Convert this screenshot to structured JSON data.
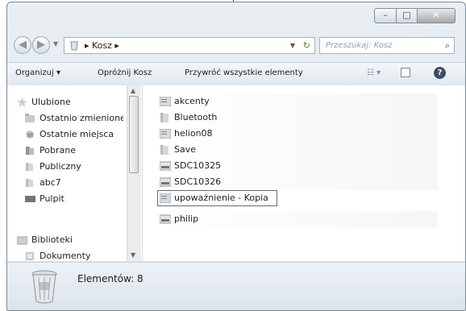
{
  "address": {
    "path": [
      "Kosz"
    ],
    "crumb_text": "▸ Kosz ▸"
  },
  "search": {
    "placeholder": "Przeszukaj: Kosz"
  },
  "toolbar": {
    "organize_label": "Organizuj ▾",
    "empty_label": "Opróżnij Kosz",
    "restore_label": "Przywróć wszystkie elementy"
  },
  "nav": {
    "favorites_label": "Ulubione",
    "favorites": [
      "Ostatnio zmienione",
      "Ostatnie miejsca",
      "Pobrane",
      "Publiczny",
      "abc7",
      "Pulpit"
    ],
    "libraries_label": "Biblioteki",
    "libraries": [
      "Dokumenty"
    ]
  },
  "files": [
    {
      "name": "akcenty",
      "type": "document"
    },
    {
      "name": "Bluetooth",
      "type": "folder"
    },
    {
      "name": "helion08",
      "type": "document"
    },
    {
      "name": "Save",
      "type": "folder"
    },
    {
      "name": "SDC10325",
      "type": "image"
    },
    {
      "name": "SDC10326",
      "type": "image"
    },
    {
      "name": "upoważnienie - Kopia",
      "type": "document",
      "selected": true
    },
    {
      "name": "philip",
      "type": "image"
    }
  ],
  "status": {
    "count_text": "Elementów: 8"
  },
  "icons": {
    "back": "back-arrow-icon",
    "forward": "forward-arrow-icon",
    "refresh": "refresh-icon",
    "search": "magnifier-icon",
    "recycle": "recycle-bin-icon",
    "help": "help-icon"
  }
}
